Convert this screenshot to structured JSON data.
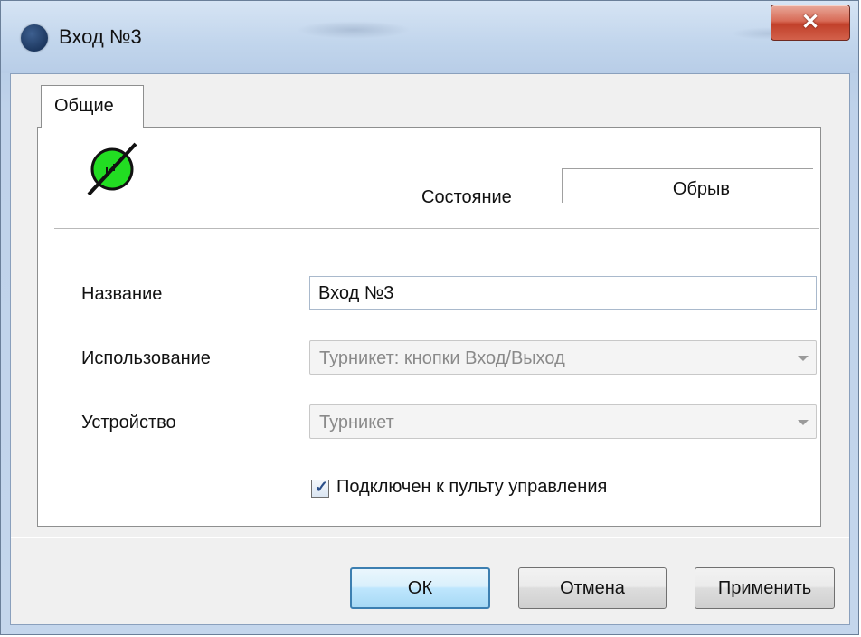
{
  "window": {
    "title": "Вход №3",
    "close_glyph": "✕"
  },
  "tabs": [
    {
      "label": "Общие",
      "active": true
    }
  ],
  "status": {
    "icon": "input-broken-line-icon",
    "icon_color": "#22dd22",
    "label": "Состояние",
    "value": "Обрыв"
  },
  "form": {
    "name_label": "Название",
    "name_value": "Вход №3",
    "usage_label": "Использование",
    "usage_value": "Турникет: кнопки Вход/Выход",
    "device_label": "Устройство",
    "device_value": "Турникет",
    "connected_label": "Подключен к пульту управления",
    "connected_checked": true
  },
  "buttons": {
    "ok": "ОК",
    "cancel": "Отмена",
    "apply": "Применить"
  },
  "colors": {
    "accent": "#3c7fb1",
    "close": "#c1402a"
  }
}
